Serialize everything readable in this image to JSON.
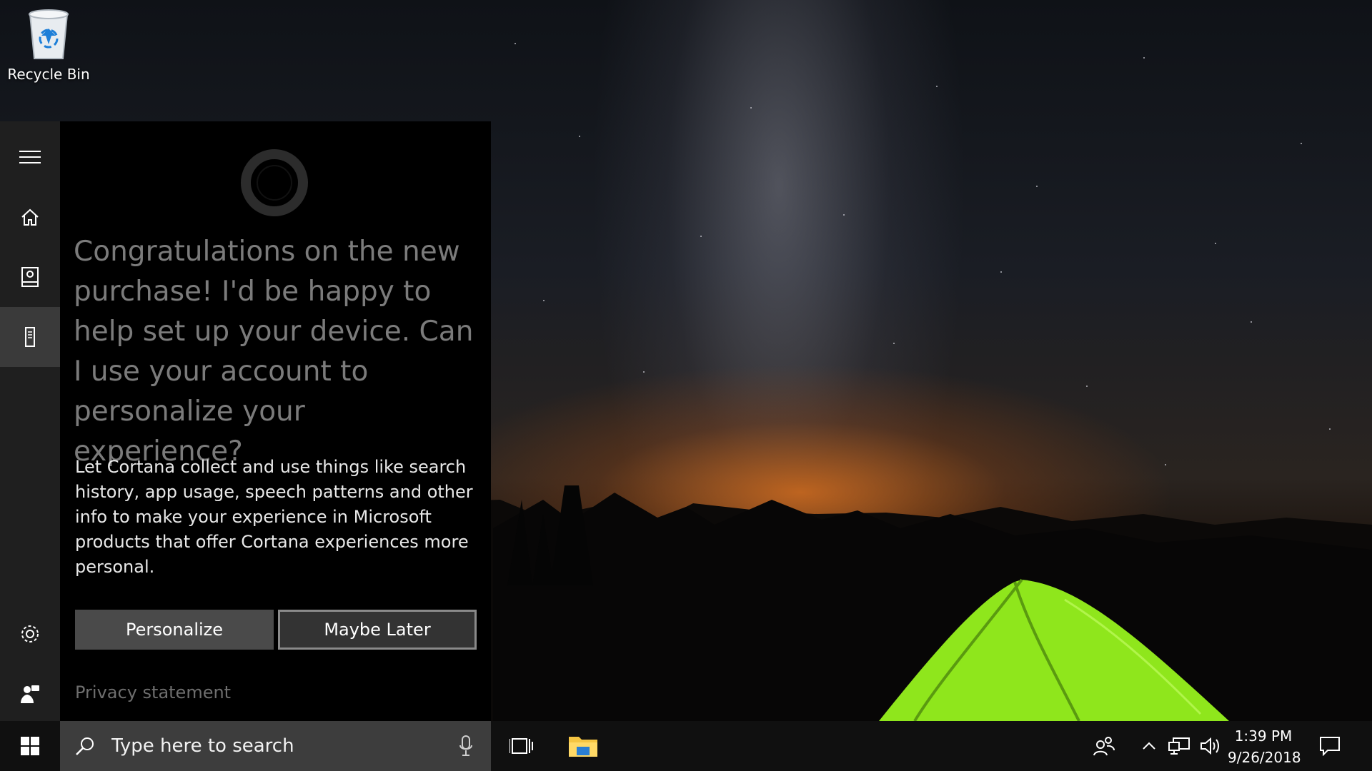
{
  "desktop": {
    "recycle_bin_label": "Recycle Bin"
  },
  "cortana": {
    "greeting": "Congratulations on the new purchase! I'd be happy to help set up your device. Can I use your account to personalize your experience?",
    "description": "Let Cortana collect and use things like search history, app usage, speech patterns and other info to make your experience in Microsoft products that offer Cortana experiences more personal.",
    "personalize_label": "Personalize",
    "maybe_later_label": "Maybe Later",
    "privacy_label": "Privacy statement",
    "rail": [
      {
        "icon": "hamburger-menu-icon"
      },
      {
        "icon": "home-icon"
      },
      {
        "icon": "notebook-icon"
      },
      {
        "icon": "devices-icon",
        "active": true
      },
      {
        "icon": "gear-icon"
      },
      {
        "icon": "feedback-icon"
      }
    ]
  },
  "taskbar": {
    "search_placeholder": "Type here to search",
    "time": "1:39 PM",
    "date": "9/26/2018"
  },
  "colors": {
    "panel_bg": "#000000",
    "rail_bg": "#1f1f1f",
    "taskbar_bg": "#101010",
    "search_bg": "#3d3d3d",
    "tent_green": "#8fe61c"
  }
}
